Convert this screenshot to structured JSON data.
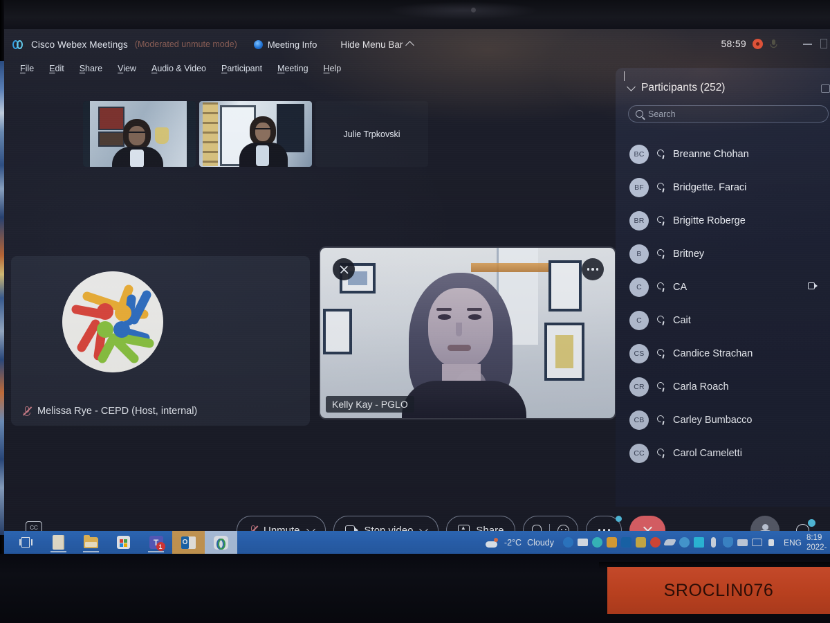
{
  "titlebar": {
    "app_title": "Cisco Webex Meetings",
    "moderated_badge": "(Moderated unmute mode)",
    "meeting_info": "Meeting Info",
    "hide_menu_bar": "Hide Menu Bar",
    "timer": "58:59"
  },
  "menubar": {
    "items": [
      {
        "pre": "",
        "key": "F",
        "post": "ile"
      },
      {
        "pre": "",
        "key": "E",
        "post": "dit"
      },
      {
        "pre": "",
        "key": "S",
        "post": "hare"
      },
      {
        "pre": "",
        "key": "V",
        "post": "iew"
      },
      {
        "pre": "",
        "key": "A",
        "post": "udio & Video"
      },
      {
        "pre": "",
        "key": "P",
        "post": "articipant"
      },
      {
        "pre": "",
        "key": "M",
        "post": "eeting"
      },
      {
        "pre": "",
        "key": "H",
        "post": "elp"
      }
    ]
  },
  "filmstrip": {
    "thumbs": [
      {
        "name": "",
        "has_video": true
      },
      {
        "name": "",
        "has_video": true
      },
      {
        "name": "Julie Trpkovski",
        "has_video": false
      }
    ]
  },
  "stage": {
    "melissa": {
      "name": "Melissa Rye - CEPD (Host, internal)",
      "muted": true,
      "avatar_colors": [
        "#e0453a",
        "#f2b233",
        "#2e6fc4",
        "#8cc63f"
      ]
    },
    "kelly": {
      "name": "Kelly Kay - PGLO",
      "pin_icon": "unpin-icon",
      "more_icon": "more-options-icon"
    }
  },
  "panel": {
    "title": "Participants (252)",
    "search_placeholder": "Search",
    "participants": [
      {
        "initials": "BC",
        "name": "Breanne Chohan",
        "muted": true,
        "camera": false
      },
      {
        "initials": "BF",
        "name": "Bridgette. Faraci",
        "muted": true,
        "camera": false
      },
      {
        "initials": "BR",
        "name": "Brigitte Roberge",
        "muted": true,
        "camera": false
      },
      {
        "initials": "B",
        "name": "Britney",
        "muted": true,
        "camera": false
      },
      {
        "initials": "C",
        "name": "CA",
        "muted": true,
        "camera": true
      },
      {
        "initials": "C",
        "name": "Cait",
        "muted": true,
        "camera": false
      },
      {
        "initials": "CS",
        "name": "Candice Strachan",
        "muted": true,
        "camera": false
      },
      {
        "initials": "CR",
        "name": "Carla Roach",
        "muted": true,
        "camera": false
      },
      {
        "initials": "CB",
        "name": "Carley Bumbacco",
        "muted": true,
        "camera": false
      },
      {
        "initials": "CC",
        "name": "Carol Cameletti",
        "muted": true,
        "camera": false
      }
    ]
  },
  "controls": {
    "cc_label": "CC",
    "unmute": "Unmute",
    "stop_video": "Stop video",
    "share": "Share",
    "leave_icon": "close-icon",
    "more_icon": "more-options-icon",
    "participants_icon": "participants-icon",
    "chat_icon": "chat-icon"
  },
  "taskbar": {
    "apps": [
      {
        "name": "task-view",
        "badge": null,
        "state": "none"
      },
      {
        "name": "document",
        "badge": null,
        "state": "open"
      },
      {
        "name": "file-explorer",
        "badge": null,
        "state": "open"
      },
      {
        "name": "microsoft-store",
        "badge": null,
        "state": "none"
      },
      {
        "name": "microsoft-teams",
        "badge": "1",
        "state": "open"
      },
      {
        "name": "outlook",
        "badge": null,
        "state": "active-orange"
      },
      {
        "name": "webex",
        "badge": null,
        "state": "active-light"
      }
    ],
    "weather_temp": "-2°C",
    "weather_desc": "Cloudy",
    "language": "ENG",
    "clock_time": "8:19",
    "clock_date": "2022-",
    "tray_icons": [
      {
        "name": "globe-icon",
        "color": "#2f7fd0"
      },
      {
        "name": "mail-icon",
        "color": "#e8eef6"
      },
      {
        "name": "moon-icon",
        "color": "#3bc4c9"
      },
      {
        "name": "image-icon",
        "color": "#e8a93a"
      },
      {
        "name": "outlook-tray-icon",
        "color": "#1a6bb5"
      },
      {
        "name": "lock-icon",
        "color": "#d6b64a"
      },
      {
        "name": "firefox-icon",
        "color": "#e24b3a"
      },
      {
        "name": "network-off-icon",
        "color": "#cfdaea"
      },
      {
        "name": "sync-icon",
        "color": "#4aa3e0"
      },
      {
        "name": "bluetooth-icon",
        "color": "#2ec5e8"
      },
      {
        "name": "microphone-icon",
        "color": "#dbe4f0"
      },
      {
        "name": "defender-icon",
        "color": "#3f8fd6"
      },
      {
        "name": "keyboard-icon",
        "color": "#cfdaea"
      },
      {
        "name": "display-icon",
        "color": "#cfdaea"
      },
      {
        "name": "volume-icon",
        "color": "#eef3fa"
      }
    ]
  },
  "asset_label": {
    "text": "SROCLIN076"
  }
}
